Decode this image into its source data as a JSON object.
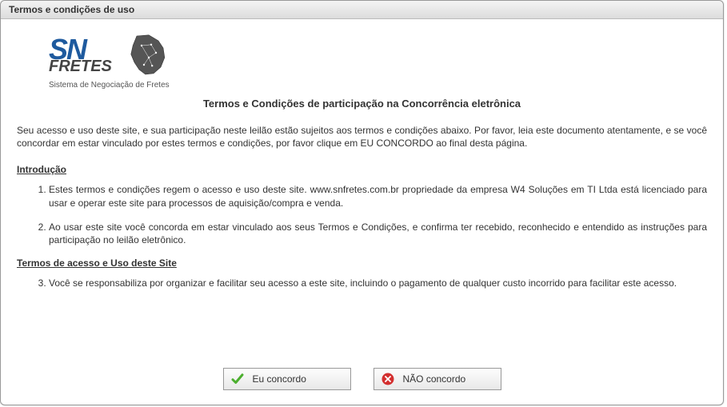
{
  "titlebar": "Termos e condições de uso",
  "logo": {
    "line1": "SN",
    "line2": "FRETES",
    "tagline": "Sistema de Negociação de Fretes"
  },
  "heading": "Termos e Condições de participação na Concorrência eletrônica",
  "intro": "Seu acesso e uso deste site, e sua participação neste leilão estão sujeitos aos termos e condições abaixo. Por favor, leia este documento atentamente, e se você concordar em estar vinculado por estes termos e condições, por favor clique em EU CONCORDO ao final desta página.",
  "section1_title": "Introdução",
  "items12": [
    "Estes termos e condições regem o acesso e uso deste site. www.snfretes.com.br propriedade da empresa W4 Soluções em TI Ltda está licenciado para usar e operar este site para processos de aquisição/compra e venda.",
    "Ao usar este site você concorda em estar vinculado aos seus Termos e Condições, e confirma ter recebido, reconhecido e entendido as instruções para participação no leilão eletrônico."
  ],
  "section2_title": "Termos de acesso e Uso deste Site",
  "items3": [
    "Você se responsabiliza por organizar e facilitar seu acesso a este site, incluindo o pagamento de qualquer custo incorrido para facilitar este acesso."
  ],
  "buttons": {
    "agree": "Eu concordo",
    "disagree": "NÃO concordo"
  }
}
